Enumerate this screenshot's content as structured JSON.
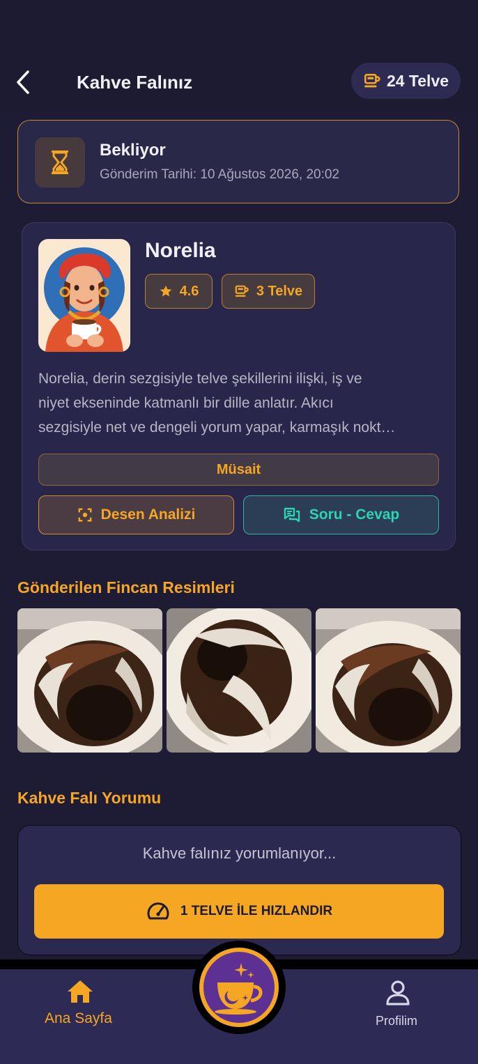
{
  "header": {
    "title": "Kahve Falınız",
    "balance": "24 Telve",
    "back_icon": "chevron-left-icon",
    "balance_icon": "coffee-cup-icon"
  },
  "status": {
    "title": "Bekliyor",
    "date": "Gönderim Tarihi: 10 Ağustos 2026, 20:02",
    "icon": "hourglass-icon"
  },
  "reader": {
    "name": "Norelia",
    "rating": "4.6",
    "cost": "3 Telve",
    "description_lines": [
      "Norelia, derin sezgisiyle telve şekillerini ilişki, iş ve",
      "niyet ekseninde katmanlı bir dille anlatır. Akıcı",
      "sezgisiyle net ve dengeli yorum yapar, karmaşık nokt…"
    ],
    "availability": "Müsait",
    "pattern_button": "Desen Analizi",
    "qa_button": "Soru - Cevap"
  },
  "images_section": {
    "title": "Gönderilen Fincan Resimleri"
  },
  "interpretation": {
    "title": "Kahve Falı Yorumu",
    "status_text": "Kahve falınız yorumlanıyor...",
    "speed_button": "1 TELVE İLE HIZLANDIR"
  },
  "nav": {
    "home_label": "Ana Sayfa",
    "profile_label": "Profilim"
  },
  "colors": {
    "accent": "#f5a623",
    "teal": "#2dd4b4",
    "background": "#1e1c35",
    "card": "#28264a"
  }
}
